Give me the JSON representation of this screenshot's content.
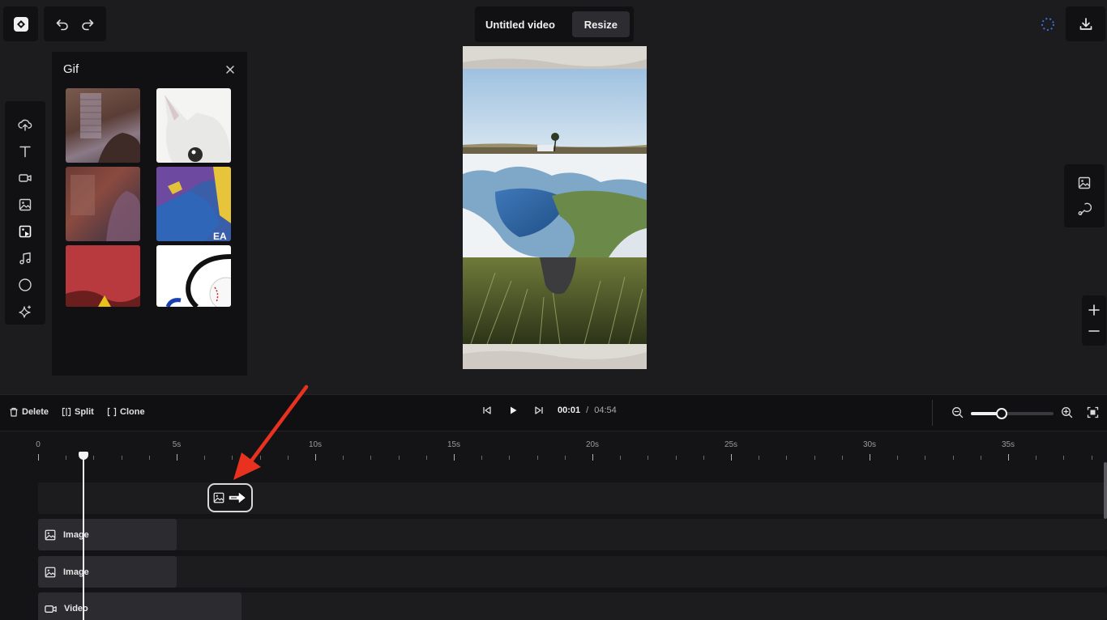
{
  "header": {
    "video_title": "Untitled video",
    "resize_label": "Resize"
  },
  "gif_panel": {
    "title": "Gif"
  },
  "timeline_controls": {
    "delete_label": "Delete",
    "split_label": "Split",
    "clone_label": "Clone",
    "time_current": "00:01",
    "time_separator": "/",
    "time_total": "04:54",
    "zoom_level_fraction": 0.37
  },
  "ruler": {
    "labels": [
      "0",
      "5s",
      "10s",
      "15s",
      "20s",
      "25s",
      "30s",
      "35s"
    ]
  },
  "tracks": [
    {
      "label": ""
    },
    {
      "label": "Image",
      "icon": "image-icon"
    },
    {
      "label": "Image",
      "icon": "image-icon"
    },
    {
      "label": "Video",
      "icon": "video-icon"
    }
  ],
  "colors": {
    "background": "#1c1c1f",
    "panel": "#111113",
    "annotation_arrow": "#e8321f",
    "loader_accent": "#3b6fe0"
  }
}
